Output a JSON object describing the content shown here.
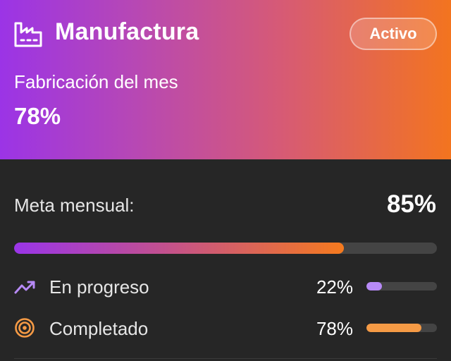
{
  "header": {
    "icon": "factory-icon",
    "title": "Manufactura",
    "badge": "Activo",
    "subtitle": "Fabricación del mes",
    "percent": "78%",
    "gradient": [
      "#9b34e6",
      "#d65a76",
      "#f3741f"
    ]
  },
  "goal": {
    "label": "Meta mensual:",
    "value": "85%",
    "progress_fraction": 0.78
  },
  "rows": [
    {
      "icon": "trending-up-icon",
      "label": "En progreso",
      "value": "22%",
      "progress_fraction": 0.22,
      "color": "#b78af7"
    },
    {
      "icon": "target-icon",
      "label": "Completado",
      "value": "78%",
      "progress_fraction": 0.78,
      "color": "#f59a45"
    }
  ],
  "colors": {
    "background": "#262626",
    "track": "#444444"
  }
}
